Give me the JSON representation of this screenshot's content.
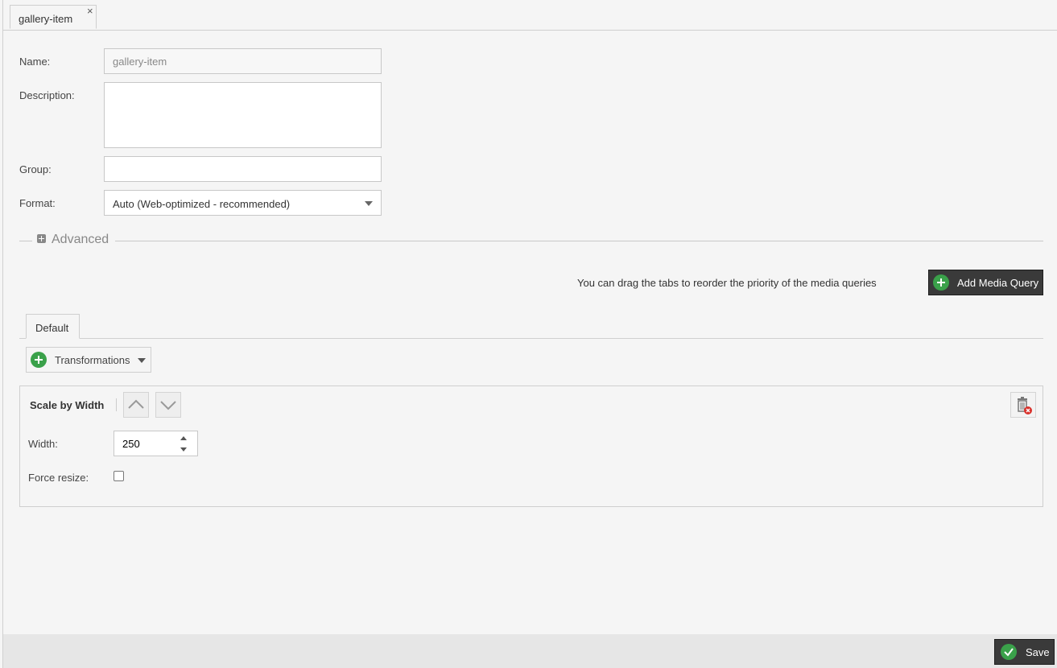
{
  "tab": {
    "label": "gallery-item",
    "close_symbol": "×"
  },
  "form": {
    "name_label": "Name:",
    "name_value": "gallery-item",
    "description_label": "Description:",
    "description_value": "",
    "group_label": "Group:",
    "group_value": "",
    "format_label": "Format:",
    "format_value": "Auto (Web-optimized - recommended)"
  },
  "advanced": {
    "label": "Advanced",
    "expanded": false
  },
  "media_queries": {
    "hint": "You can drag the tabs to reorder the priority of the media queries",
    "add_button_label": "Add Media Query",
    "tabs": [
      {
        "label": "Default"
      }
    ]
  },
  "transformations": {
    "menu_label": "Transformations",
    "items": [
      {
        "title": "Scale by Width",
        "width_label": "Width:",
        "width_value": "250",
        "force_resize_label": "Force resize:",
        "force_resize_checked": false
      }
    ]
  },
  "footer": {
    "save_label": "Save"
  },
  "colors": {
    "accent_green": "#3aa14a",
    "dark_button": "#3a3a3a",
    "delete_red": "#d9322c"
  }
}
